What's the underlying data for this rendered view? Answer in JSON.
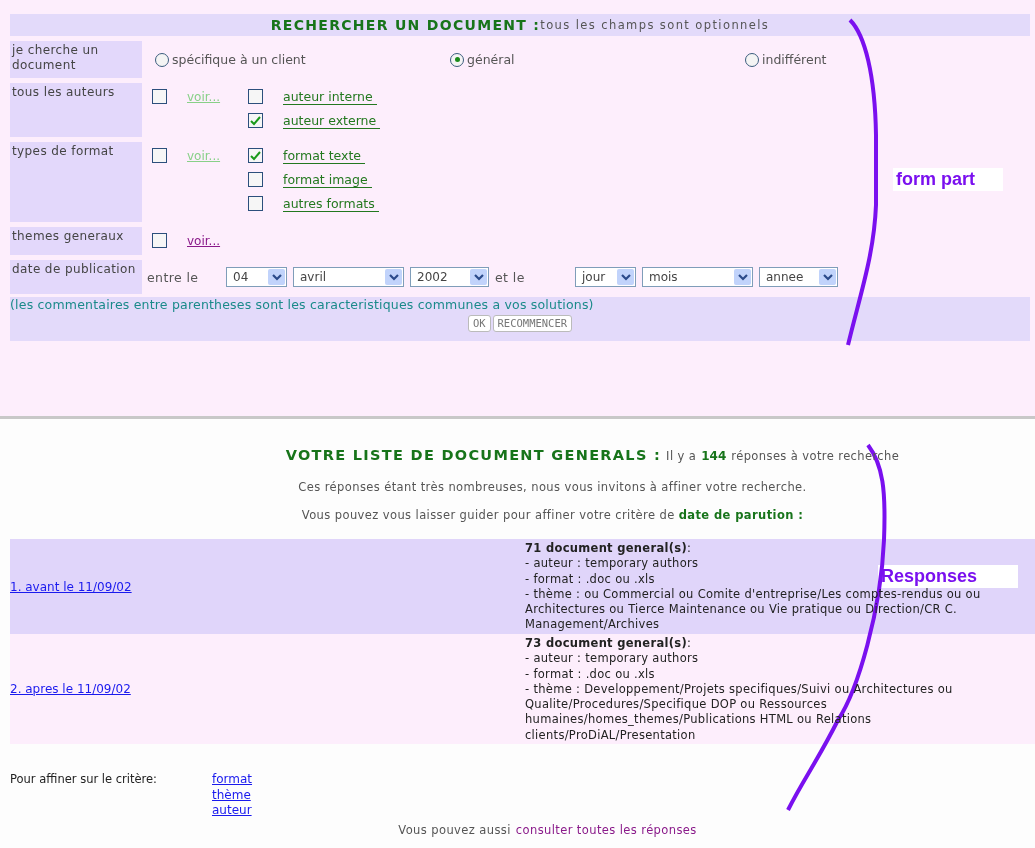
{
  "form": {
    "title": "RECHERCHER UN DOCUMENT :",
    "subtitle": "tous les champs sont optionnels",
    "rows": [
      {
        "kind": "radio",
        "label": "je cherche un document",
        "options": [
          {
            "label": "spécifique à un client",
            "selected": false
          },
          {
            "label": "général",
            "selected": true
          },
          {
            "label": "indifférent",
            "selected": false
          }
        ]
      },
      {
        "kind": "checklist",
        "label": "tous les auteurs",
        "checked": false,
        "voir": {
          "label": "voir...",
          "visited": false
        },
        "items": [
          {
            "label": "auteur interne",
            "checked": false
          },
          {
            "label": "auteur externe",
            "checked": true
          }
        ]
      },
      {
        "kind": "checklist",
        "label": "types de format",
        "checked": false,
        "voir": {
          "label": "voir...",
          "visited": false
        },
        "items": [
          {
            "label": "format texte",
            "checked": true
          },
          {
            "label": "format image",
            "checked": false
          },
          {
            "label": "autres formats",
            "checked": false
          }
        ]
      },
      {
        "kind": "checklist",
        "label": "themes generaux",
        "checked": false,
        "voir": {
          "label": "voir...",
          "visited": true
        },
        "items": []
      },
      {
        "kind": "date",
        "label": "date de publication",
        "from_label": "entre le",
        "from": [
          "04",
          "avril",
          "2002"
        ],
        "to_label": "et le",
        "to": [
          "jour",
          "mois",
          "annee"
        ]
      }
    ],
    "note": "(les commentaires entre parentheses sont les caracteristiques communes a vos solutions)",
    "buttons": [
      "OK",
      "RECOMMENCER"
    ]
  },
  "results": {
    "title": "VOTRE LISTE DE DOCUMENT GENERALS :",
    "count_prefix": "Il y a",
    "count": "144",
    "count_suffix": "réponses à votre recherche",
    "advice": "Ces réponses étant très nombreuses, nous vous invitons à affiner votre recherche.",
    "guide": "Vous pouvez vous laisser guider pour affiner votre critère de **date de parution :**",
    "rows": [
      {
        "link": "1. avant le 11/09/02",
        "summary": "**71 document general(s)**:",
        "lines": [
          "- auteur : temporary authors",
          "- format : .doc ou .xls",
          "- thème : ou Commercial ou Comite d'entreprise/Les comptes-rendus ou ou Architectures ou Tierce Maintenance ou Vie pratique ou Direction/CR C. Management/Archives"
        ]
      },
      {
        "link": "2. apres le 11/09/02",
        "summary": "**73 document general(s)**:",
        "lines": [
          "- auteur : temporary authors",
          "- format : .doc ou .xls",
          "- thème : Developpement/Projets specifiques/Suivi ou Architectures ou Qualite/Procedures/Specifique DOP ou Ressources humaines/homes_themes/Publications HTML ou Relations clients/ProDiAL/Presentation"
        ]
      }
    ],
    "refine_label": "Pour affiner sur le critère:",
    "refine_links": [
      "format",
      "thème",
      "auteur"
    ],
    "footer_prefix": "Vous pouvez aussi",
    "footer_link": "consulter toutes les réponses"
  },
  "annotations": [
    {
      "label": "form part"
    },
    {
      "label": "Responses"
    }
  ]
}
